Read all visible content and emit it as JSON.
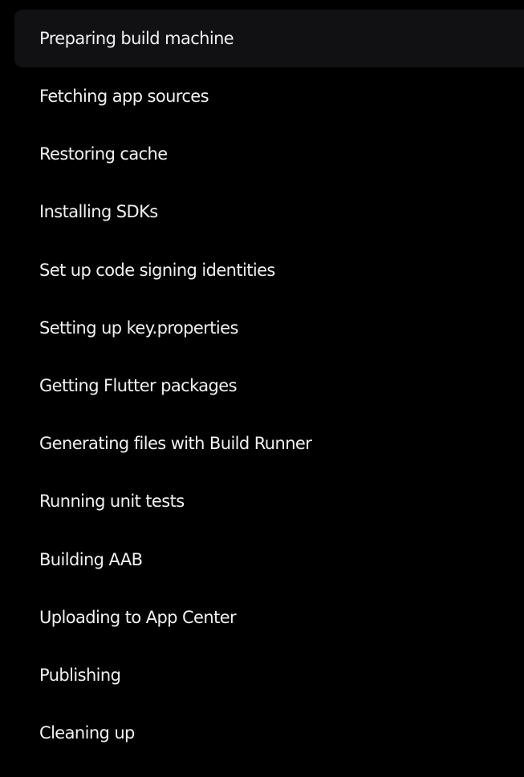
{
  "build_steps": {
    "active_index": 0,
    "items": [
      {
        "label": "Preparing build machine"
      },
      {
        "label": "Fetching app sources"
      },
      {
        "label": "Restoring cache"
      },
      {
        "label": "Installing SDKs"
      },
      {
        "label": "Set up code signing identities"
      },
      {
        "label": "Setting up key.properties"
      },
      {
        "label": "Getting Flutter packages"
      },
      {
        "label": "Generating files with Build Runner"
      },
      {
        "label": "Running unit tests"
      },
      {
        "label": "Building AAB"
      },
      {
        "label": "Uploading to App Center"
      },
      {
        "label": "Publishing"
      },
      {
        "label": "Cleaning up"
      }
    ]
  },
  "colors": {
    "panel_background": "#000000",
    "active_row_background": "#111114",
    "text": "#f1f1f1"
  }
}
